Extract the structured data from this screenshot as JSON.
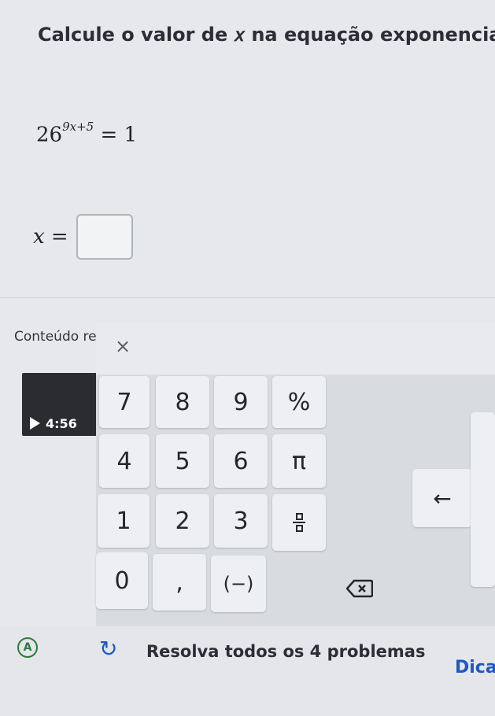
{
  "question": {
    "text": "Calcule o valor de 𝑥 na equação exponencial."
  },
  "equation": {
    "base": "26",
    "exponent": "9x+5",
    "rhs": "= 1"
  },
  "answer": {
    "variable": "x =",
    "value": ""
  },
  "related": {
    "label": "Conteúdo re",
    "video_duration": "4:56"
  },
  "keypad": {
    "close": "×",
    "keys": [
      "7",
      "8",
      "9",
      "%",
      "4",
      "5",
      "6",
      "π",
      "1",
      "2",
      "3",
      "0",
      ",",
      "(−)"
    ],
    "arrow_left": "←"
  },
  "footer": {
    "badge": "A",
    "reload_icon": "↻",
    "progress": "Resolva todos os 4 problemas",
    "hint": "Dica"
  }
}
